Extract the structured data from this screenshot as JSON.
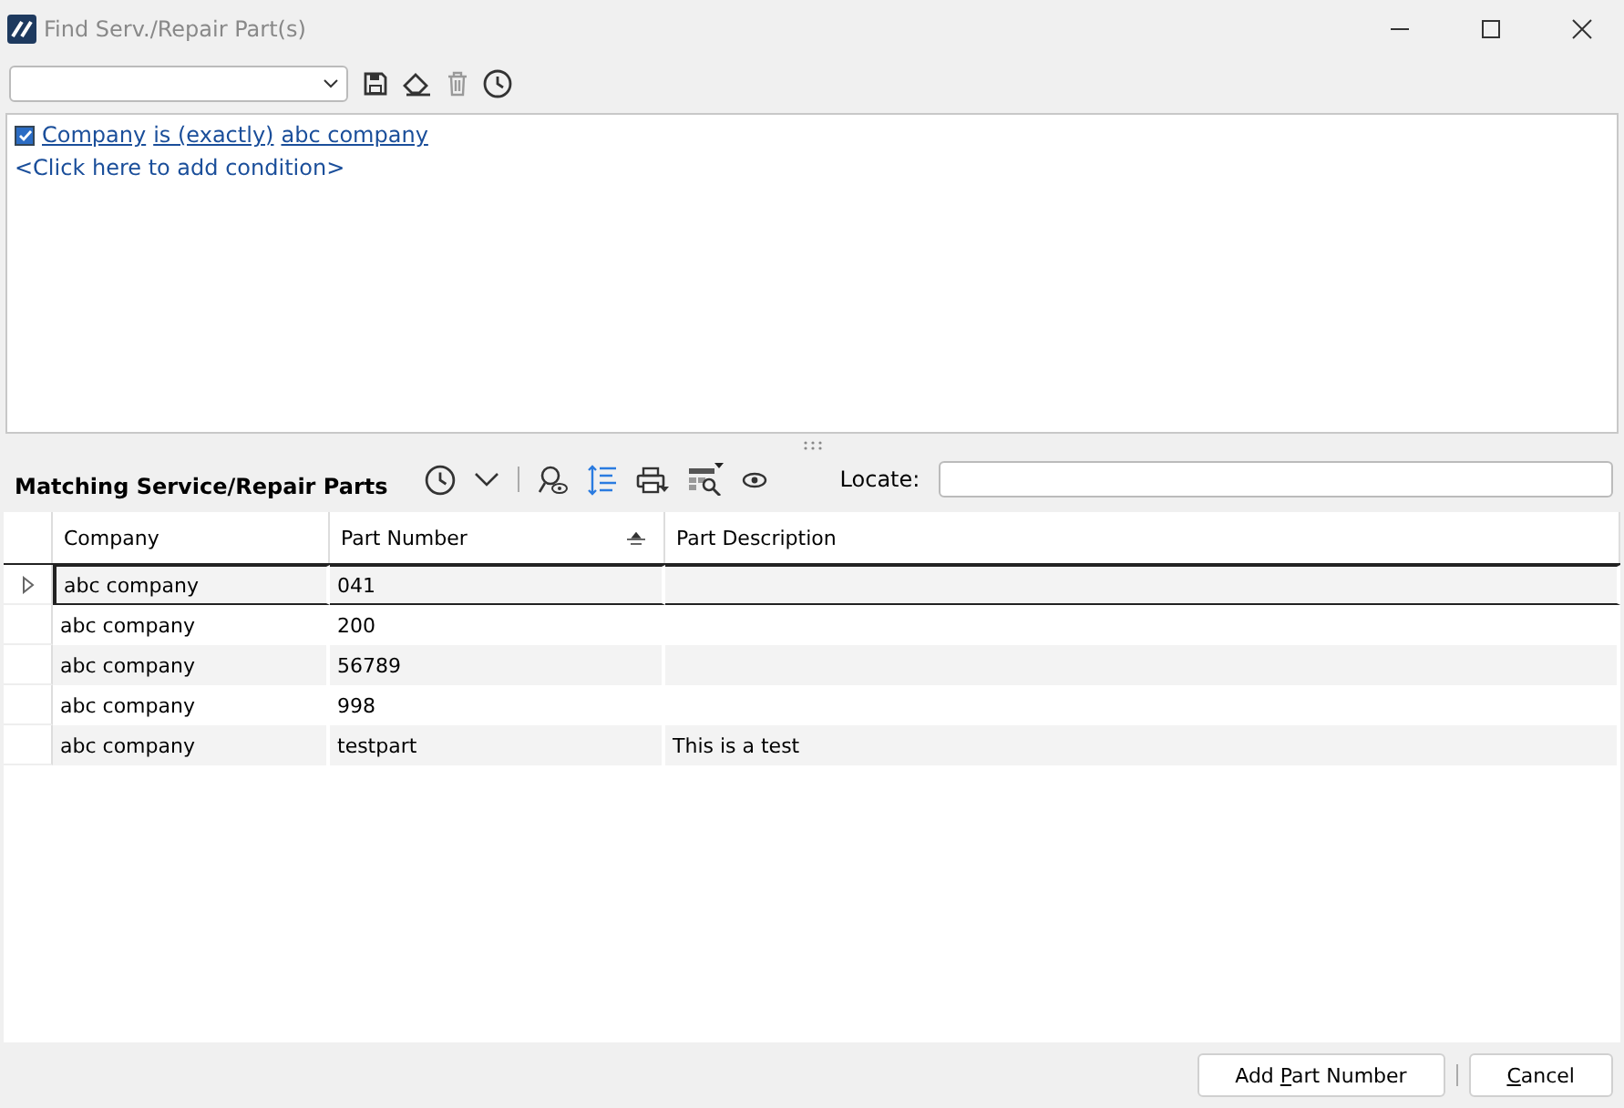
{
  "window": {
    "title": "Find Serv./Repair Part(s)"
  },
  "conditions": [
    {
      "checked": true,
      "field": "Company",
      "operator": "is (exactly)",
      "value": "abc company"
    }
  ],
  "add_condition": "<Click here to add condition>",
  "results": {
    "title": "Matching Service/Repair Parts",
    "locate_label": "Locate:",
    "columns": [
      {
        "label": "Company",
        "sorted": false
      },
      {
        "label": "Part Number",
        "sorted": true
      },
      {
        "label": "Part Description",
        "sorted": false
      }
    ],
    "rows": [
      {
        "selected": true,
        "cells": [
          "abc company",
          "041",
          ""
        ]
      },
      {
        "selected": false,
        "cells": [
          "abc company",
          "200",
          ""
        ]
      },
      {
        "selected": false,
        "cells": [
          "abc company",
          "56789",
          ""
        ]
      },
      {
        "selected": false,
        "cells": [
          "abc company",
          "998",
          ""
        ]
      },
      {
        "selected": false,
        "cells": [
          "abc company",
          "testpart",
          "This is a test"
        ]
      }
    ]
  },
  "buttons": [
    {
      "before": "Add ",
      "key": "P",
      "after": "art Number"
    },
    {
      "key": "C",
      "after": "ancel"
    }
  ]
}
